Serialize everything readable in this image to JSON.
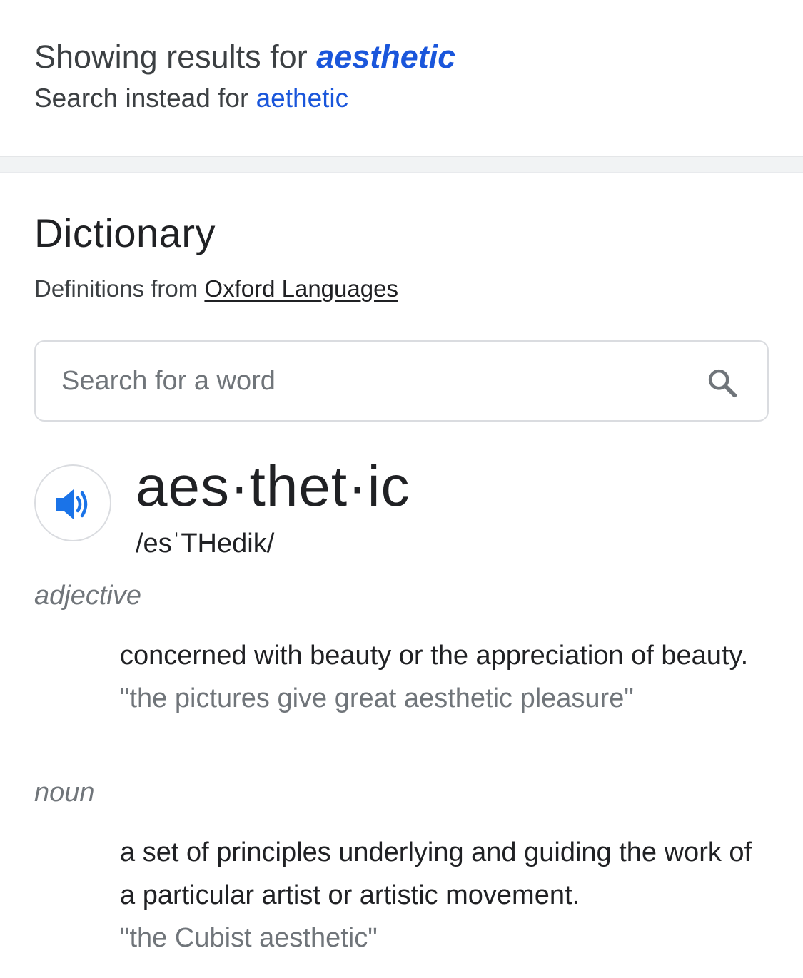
{
  "spelling": {
    "showing_prefix": "Showing results for ",
    "corrected_query": "aesthetic",
    "instead_prefix": "Search instead for ",
    "original_query": "aethetic"
  },
  "dictionary": {
    "title": "Dictionary",
    "source_prefix": "Definitions from ",
    "source_link": "Oxford Languages",
    "search": {
      "placeholder": "Search for a word",
      "value": ""
    },
    "entry": {
      "headword": "aes·thet·ic",
      "phonetic": "/esˈTHedik/",
      "senses": [
        {
          "part_of_speech": "adjective",
          "definition": "concerned with beauty or the appreciation of beauty.",
          "example": "\"the pictures give great aesthetic pleasure\""
        },
        {
          "part_of_speech": "noun",
          "definition": "a set of principles underlying and guiding the work of a particular artist or artistic movement.",
          "example": "\"the Cubist aesthetic\""
        }
      ]
    }
  },
  "icons": {
    "speaker": "speaker-icon",
    "search": "search-icon"
  },
  "colors": {
    "link": "#1a56db",
    "speaker": "#1a73e8",
    "muted_text": "#70757a"
  }
}
